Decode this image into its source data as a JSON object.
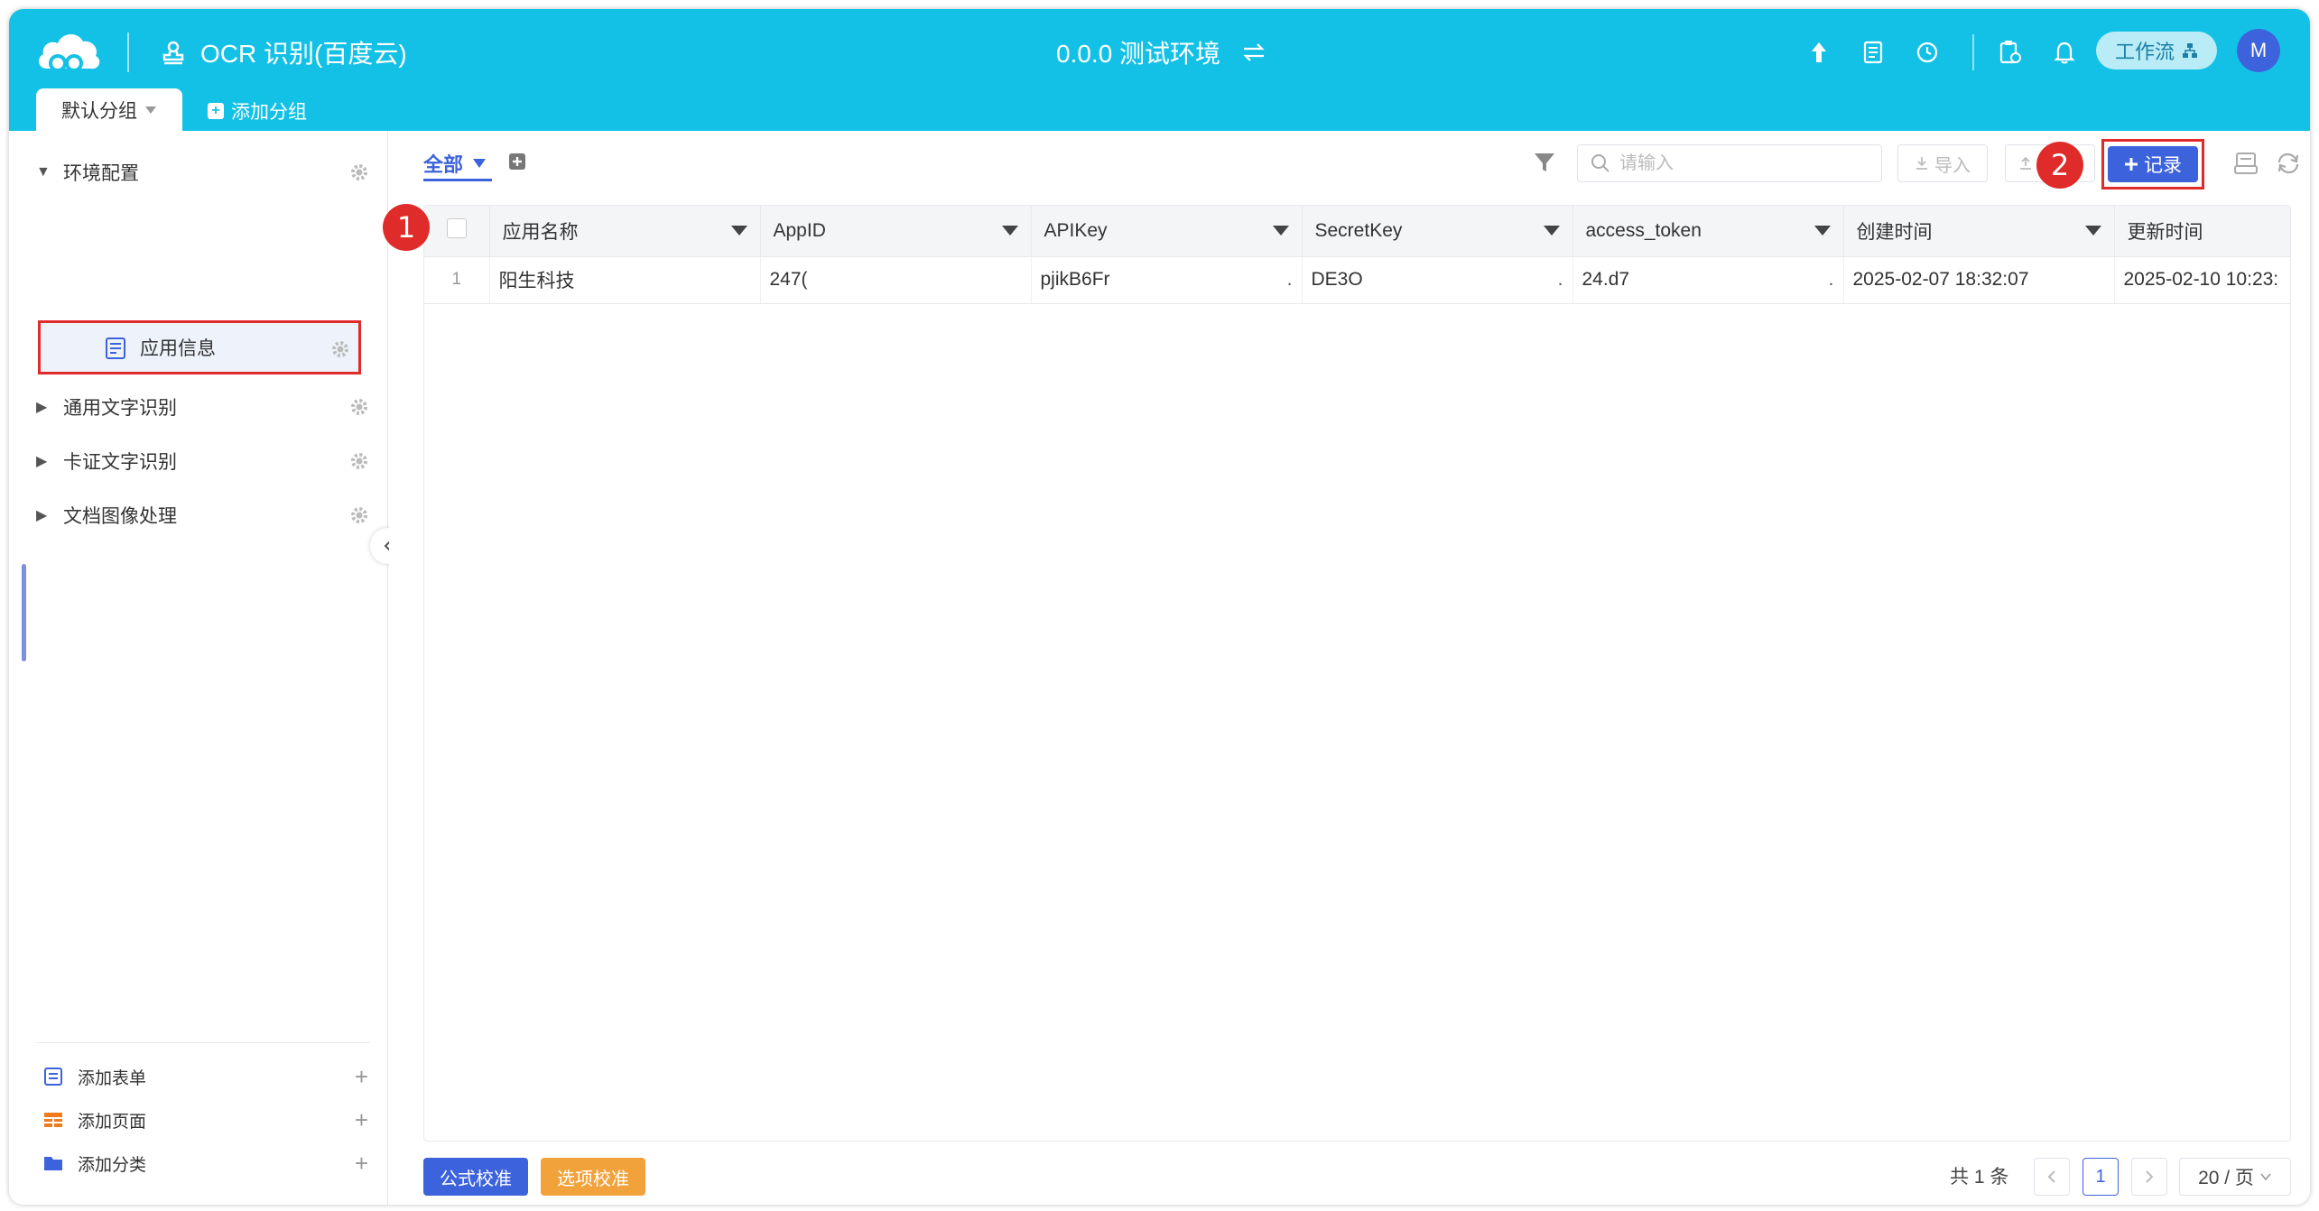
{
  "header": {
    "app_title": "OCR 识别(百度云)",
    "env_title": "0.0.0 测试环境",
    "workflow_label": "工作流",
    "avatar_letter": "M",
    "bg_color": "#14c1e6",
    "tabs": {
      "default_group": "默认分组",
      "add_group": "添加分组"
    }
  },
  "sidebar": {
    "items": [
      {
        "label": "环境配置",
        "expanded": true
      },
      {
        "label": "应用信息",
        "selected": true
      },
      {
        "label": "通用文字识别",
        "expanded": false
      },
      {
        "label": "卡证文字识别",
        "expanded": false
      },
      {
        "label": "文档图像处理",
        "expanded": false
      }
    ],
    "bottom": {
      "add_form": "添加表单",
      "add_page": "添加页面",
      "add_category": "添加分类"
    }
  },
  "toolbar": {
    "view_tab": "全部",
    "search_placeholder": "请输入",
    "import_label": "导入",
    "record_label": "记录",
    "accent_color": "#3d63dc"
  },
  "table": {
    "columns": [
      "应用名称",
      "AppID",
      "APIKey",
      "SecretKey",
      "access_token",
      "创建时间",
      "更新时间"
    ],
    "rows": [
      {
        "num": "1",
        "app_name": "阳生科技",
        "app_id": "247(",
        "api_key": "pjikB6Fr",
        "secret_key": "DE3O",
        "access_token": "24.d7",
        "created": "2025-02-07 18:32:07",
        "updated": "2025-02-10 10:23:"
      }
    ]
  },
  "footer": {
    "formula_btn": "公式校准",
    "option_btn": "选项校准",
    "total": "共 1 条",
    "current_page": "1",
    "page_size": "20 / 页"
  },
  "annotations": {
    "step1": "1",
    "step2": "2"
  }
}
